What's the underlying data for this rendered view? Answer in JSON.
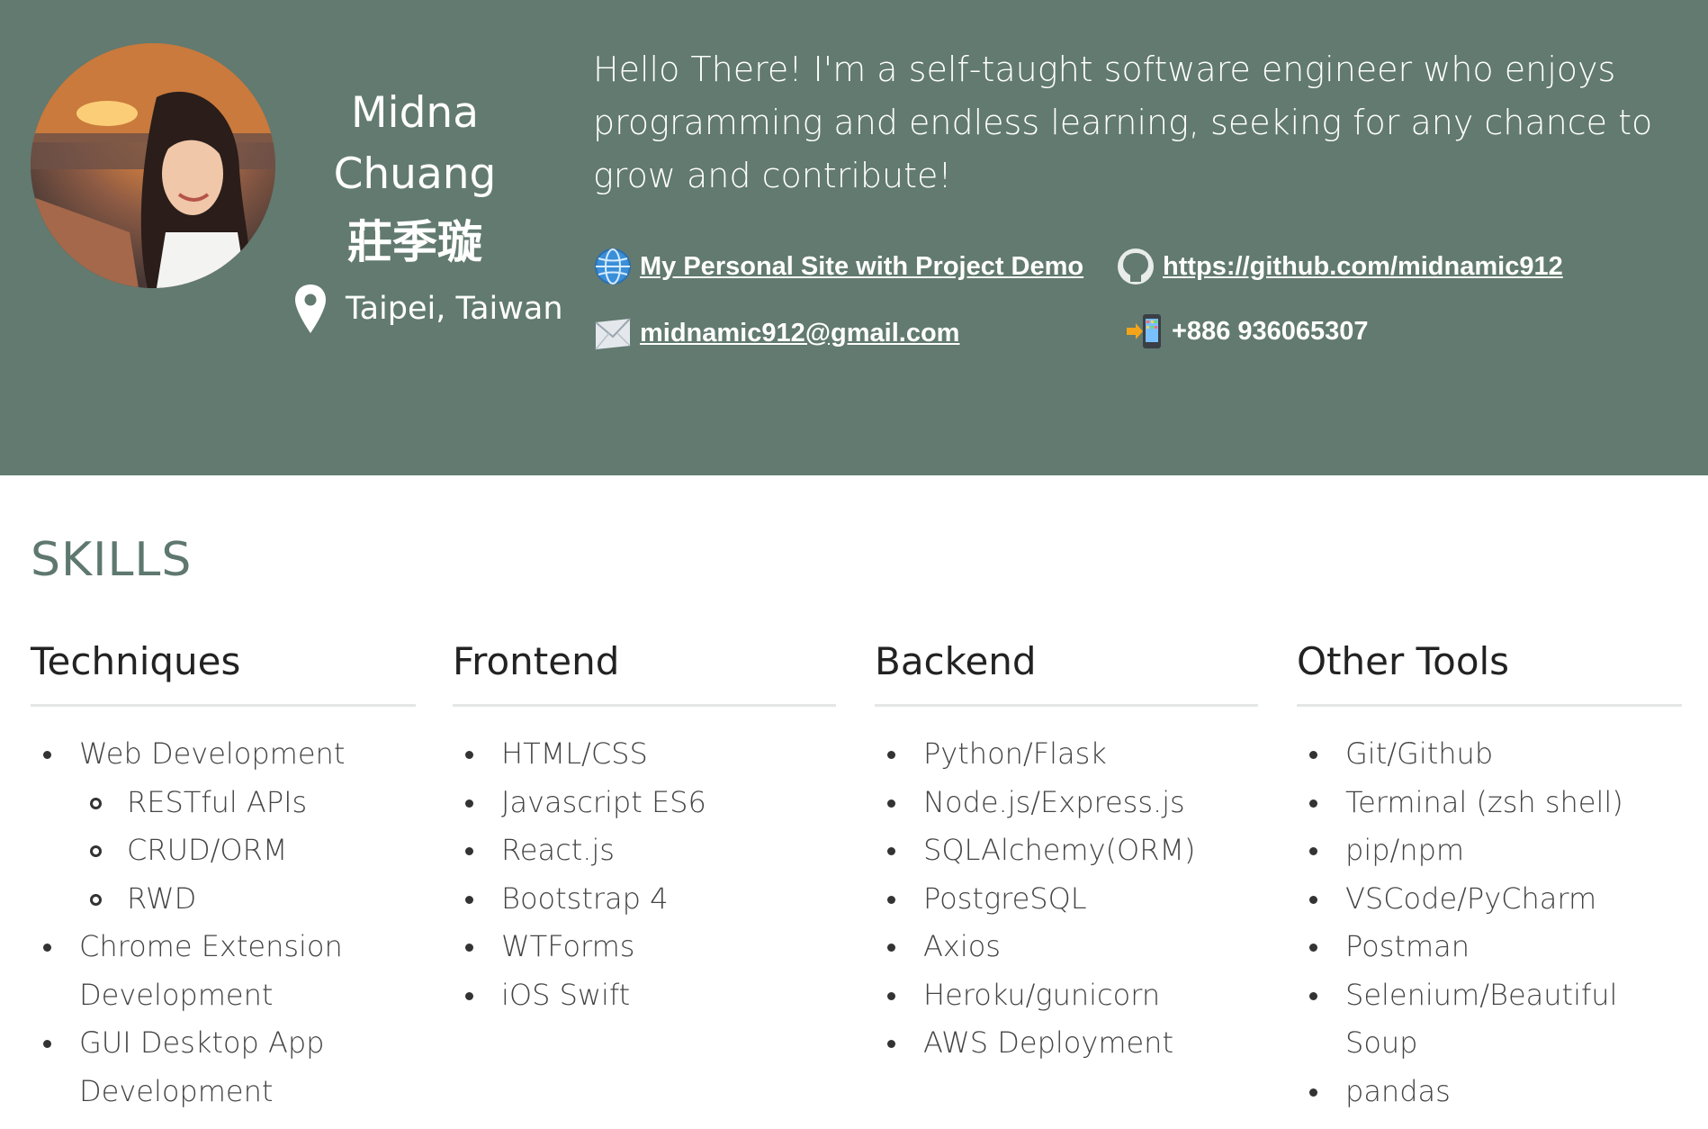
{
  "profile": {
    "first_name": "Midna",
    "last_name": "Chuang",
    "chinese_name": "莊季璇",
    "location": "Taipei, Taiwan",
    "intro": "Hello There! I'm a self-taught software engineer who enjoys programming and endless learning, seeking for any chance to grow and contribute!"
  },
  "contacts": {
    "site": {
      "label": "My Personal Site with Project Demo",
      "icon": "globe-icon"
    },
    "github": {
      "label": "https://github.com/midnamic912",
      "icon": "github-icon"
    },
    "email": {
      "label": "midnamic912@gmail.com",
      "icon": "envelope-icon"
    },
    "phone": {
      "label": "+886 936065307",
      "icon": "mobile-phone-icon"
    }
  },
  "colors": {
    "header_bg": "#627a70",
    "section_title": "#5e7870"
  },
  "skills": {
    "title": "SKILLS",
    "columns": [
      {
        "heading": "Techniques",
        "items": [
          {
            "text": "Web Development",
            "level": 1
          },
          {
            "text": "RESTful APIs",
            "level": 2
          },
          {
            "text": "CRUD/ORM",
            "level": 2
          },
          {
            "text": "RWD",
            "level": 2
          },
          {
            "text": "Chrome Extension Development",
            "level": 1
          },
          {
            "text": "GUI Desktop App Development",
            "level": 1
          }
        ]
      },
      {
        "heading": "Frontend",
        "items": [
          {
            "text": "HTML/CSS",
            "level": 1
          },
          {
            "text": "Javascript ES6",
            "level": 1
          },
          {
            "text": "React.js",
            "level": 1
          },
          {
            "text": "Bootstrap 4",
            "level": 1
          },
          {
            "text": "WTForms",
            "level": 1
          },
          {
            "text": "iOS Swift",
            "level": 1
          }
        ]
      },
      {
        "heading": "Backend",
        "items": [
          {
            "text": "Python/Flask",
            "level": 1
          },
          {
            "text": "Node.js/Express.js",
            "level": 1
          },
          {
            "text": "SQLAlchemy(ORM)",
            "level": 1
          },
          {
            "text": "PostgreSQL",
            "level": 1
          },
          {
            "text": "Axios",
            "level": 1
          },
          {
            "text": "Heroku/gunicorn",
            "level": 1
          },
          {
            "text": "AWS Deployment",
            "level": 1
          }
        ]
      },
      {
        "heading": "Other Tools",
        "items": [
          {
            "text": "Git/Github",
            "level": 1
          },
          {
            "text": "Terminal (zsh shell)",
            "level": 1
          },
          {
            "text": "pip/npm",
            "level": 1
          },
          {
            "text": "VSCode/PyCharm",
            "level": 1
          },
          {
            "text": "Postman",
            "level": 1
          },
          {
            "text": "Selenium/Beautiful Soup",
            "level": 1
          },
          {
            "text": "pandas",
            "level": 1
          }
        ]
      }
    ]
  }
}
